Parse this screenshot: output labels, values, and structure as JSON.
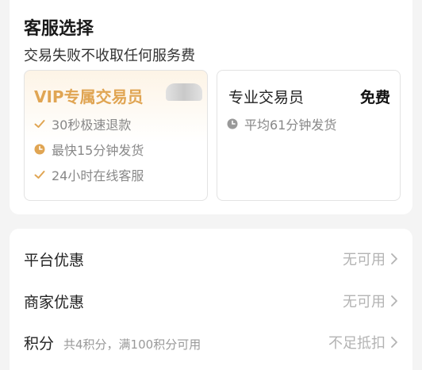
{
  "service": {
    "title": "客服选择",
    "subtitle": "交易失败不收取任何服务费",
    "vip": {
      "title": "VIP专属交易员",
      "features": [
        {
          "icon": "check-icon",
          "text": "30秒极速退款"
        },
        {
          "icon": "clock-icon",
          "text": "最快15分钟发货"
        },
        {
          "icon": "check-icon",
          "text": "24小时在线客服"
        }
      ]
    },
    "pro": {
      "title": "专业交易员",
      "price_label": "免费",
      "features": [
        {
          "icon": "clock-icon",
          "text": "平均61分钟发货"
        }
      ]
    }
  },
  "discounts": [
    {
      "label": "平台优惠",
      "desc": "",
      "status": "无可用"
    },
    {
      "label": "商家优惠",
      "desc": "",
      "status": "无可用"
    },
    {
      "label": "积分",
      "desc": "共4积分，满100积分可用",
      "status": "不足抵扣"
    }
  ],
  "colors": {
    "vip_gold": "#e0a553",
    "muted": "#999999",
    "background": "#f4f4f4"
  }
}
